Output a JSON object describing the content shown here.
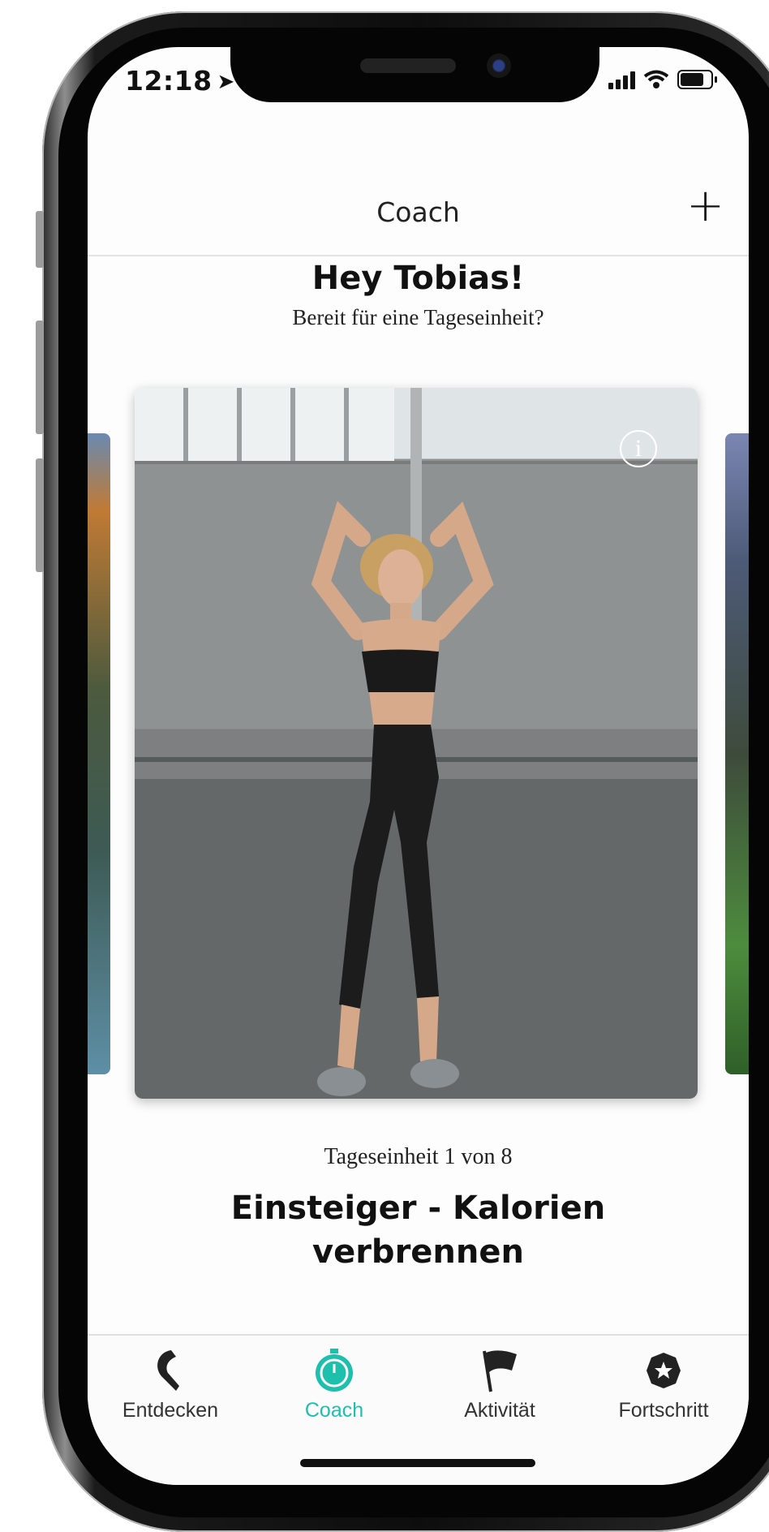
{
  "status_bar": {
    "time": "12:18",
    "location_glyph": "➤"
  },
  "nav": {
    "title": "Coach",
    "plus_label": "+"
  },
  "greeting": {
    "title": "Hey Tobias!",
    "subtitle": "Bereit für eine Tageseinheit?"
  },
  "card": {
    "info_label": "i"
  },
  "session": {
    "counter": "Tageseinheit 1 von 8",
    "title": "Einsteiger - Kalorien verbrennen"
  },
  "tabs": [
    {
      "label": "Entdecken",
      "icon": "leaf-icon"
    },
    {
      "label": "Coach",
      "icon": "stopwatch-icon",
      "active": true
    },
    {
      "label": "Aktivität",
      "icon": "flag-icon"
    },
    {
      "label": "Fortschritt",
      "icon": "star-badge-icon"
    }
  ],
  "colors": {
    "accent": "#1fbfad"
  }
}
